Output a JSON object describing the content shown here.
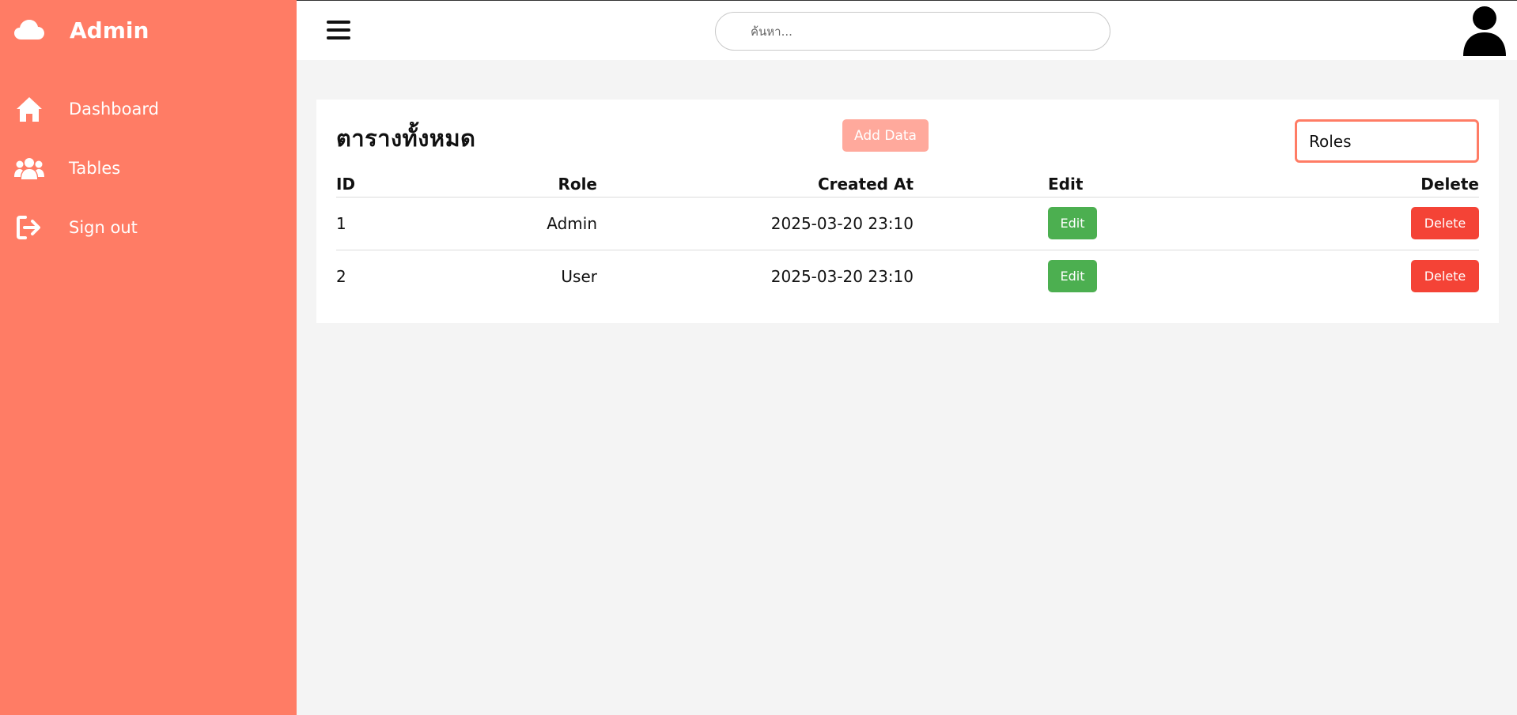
{
  "brand": {
    "title": "Admin",
    "icon": "cloud-icon"
  },
  "sidebar": {
    "items": [
      {
        "label": "Dashboard",
        "icon": "home-icon"
      },
      {
        "label": "Tables",
        "icon": "users-icon"
      },
      {
        "label": "Sign out",
        "icon": "sign-out-icon"
      }
    ]
  },
  "topbar": {
    "search_placeholder": "ค้นหา...",
    "menu_icon": "hamburger-icon",
    "avatar_icon": "user-avatar-icon"
  },
  "card": {
    "title": "ตารางทั้งหมด",
    "add_button": "Add Data",
    "select_value": "Roles"
  },
  "table": {
    "headers": {
      "id": "ID",
      "role": "Role",
      "created": "Created At",
      "edit": "Edit",
      "delete": "Delete"
    },
    "rows": [
      {
        "id": "1",
        "role": "Admin",
        "created": "2025-03-20 23:10",
        "edit": "Edit",
        "delete": "Delete"
      },
      {
        "id": "2",
        "role": "User",
        "created": "2025-03-20 23:10",
        "edit": "Edit",
        "delete": "Delete"
      }
    ]
  },
  "colors": {
    "sidebar": "#ff7c65",
    "add_button": "#ffa99c",
    "edit": "#4caf50",
    "delete": "#f44336"
  }
}
